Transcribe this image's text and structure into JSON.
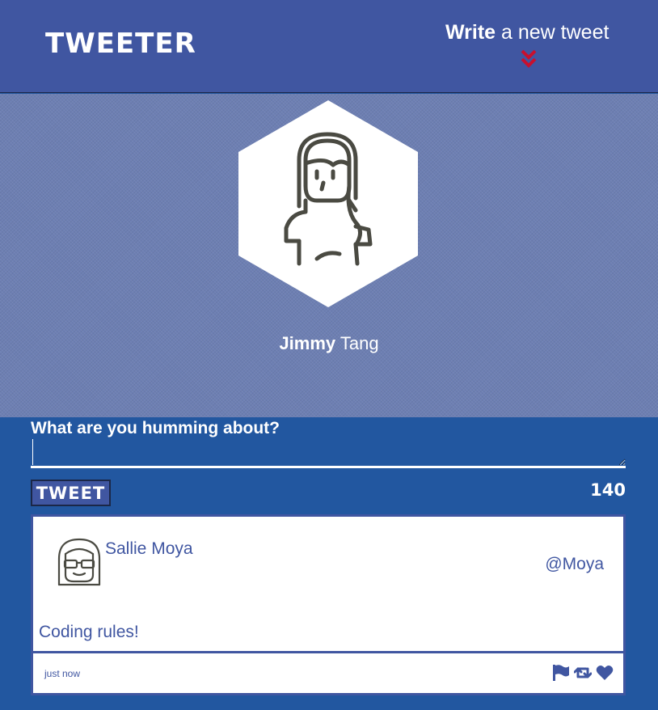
{
  "nav": {
    "brand": "TWEETER",
    "compose_toggle": {
      "bold": "Write",
      "rest": " a new tweet"
    },
    "accent_color": "#c8102e",
    "icon": "double-chevron-down-icon"
  },
  "profile": {
    "first_name": "Jimmy",
    "last_name": " Tang",
    "avatar_icon": "woman-avatar-icon"
  },
  "compose": {
    "label": "What are you humming about?",
    "input_value": "",
    "button_label": "TWEET",
    "counter": "140"
  },
  "tweets": [
    {
      "name": "Sallie Moya",
      "handle": "@Moya",
      "text": "Coding rules!",
      "time": "just now",
      "avatar_icon": "girl-with-glasses-avatar-icon",
      "actions": [
        "flag-icon",
        "retweet-icon",
        "heart-icon"
      ]
    }
  ],
  "colors": {
    "primary": "#4056a1",
    "compose_bg": "#2257a0",
    "hero": "#6d7fb3"
  }
}
